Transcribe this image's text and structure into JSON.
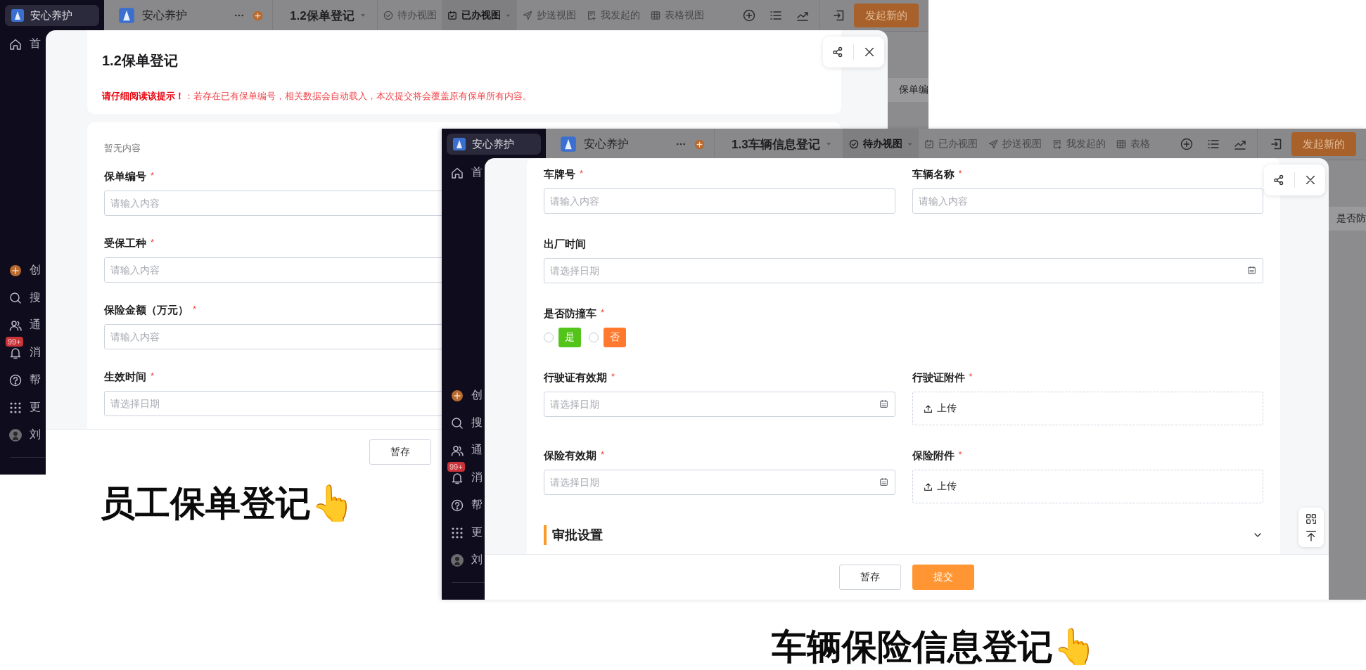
{
  "shots": [
    {
      "sidebar": {
        "brand": "安心养护",
        "items": [
          {
            "kind": "home",
            "label": "首"
          }
        ],
        "bottom_items": [
          {
            "kind": "create",
            "label": "创"
          },
          {
            "kind": "search",
            "label": "搜"
          },
          {
            "kind": "contacts",
            "label": "通"
          },
          {
            "kind": "bell",
            "label": "消",
            "badge": "99+"
          },
          {
            "kind": "help",
            "label": "帮"
          },
          {
            "kind": "apps",
            "label": "更"
          },
          {
            "kind": "avatar",
            "label": "刘"
          }
        ]
      },
      "topbar": {
        "app_name": "安心养护",
        "form_name": "1.2保单登记",
        "views": [
          {
            "kind": "todo",
            "label": "待办视图",
            "selected": false
          },
          {
            "kind": "done",
            "label": "已办视图",
            "selected": true
          },
          {
            "kind": "cc",
            "label": "抄送视图",
            "selected": false
          },
          {
            "kind": "mine",
            "label": "我发起的",
            "selected": false
          },
          {
            "kind": "table",
            "label": "表格视图",
            "selected": false
          }
        ],
        "new_button": "发起新的"
      },
      "behind_column": "保单编",
      "modal": {
        "title": "1.2保单登记",
        "notice": "**请仔细阅读该提示！**：若存在已有保单编号，相关数据会自动载入，本次提交将会覆盖原有保单所有内容。",
        "cards": [
          {
            "hint": "暂无内容",
            "rows": [
              [
                {
                  "kind": "text",
                  "label": "保单编号",
                  "required_mark": "*",
                  "placeholder": "请输入内容"
                }
              ],
              [
                {
                  "kind": "text",
                  "label": "受保工种",
                  "required_mark": "*",
                  "placeholder": "请输入内容"
                }
              ],
              [
                {
                  "kind": "text",
                  "label": "保险金额（万元）",
                  "required_mark": "*",
                  "placeholder": "请输入内容"
                }
              ],
              [
                {
                  "kind": "text",
                  "label": "生效时间",
                  "required_mark": "*",
                  "placeholder": "请选择日期"
                }
              ]
            ]
          }
        ],
        "buttons": [
          {
            "kind": "secondary",
            "label": "暂存"
          }
        ]
      }
    },
    {
      "sidebar": {
        "brand": "安心养护",
        "items": [
          {
            "kind": "home",
            "label": "首"
          }
        ],
        "bottom_items": [
          {
            "kind": "create",
            "label": "创"
          },
          {
            "kind": "search",
            "label": "搜"
          },
          {
            "kind": "contacts",
            "label": "通"
          },
          {
            "kind": "bell",
            "label": "消",
            "badge": "99+"
          },
          {
            "kind": "help",
            "label": "帮"
          },
          {
            "kind": "apps",
            "label": "更"
          },
          {
            "kind": "avatar",
            "label": "刘"
          }
        ]
      },
      "topbar": {
        "app_name": "安心养护",
        "form_name": "1.3车辆信息登记",
        "views": [
          {
            "kind": "todo",
            "label": "待办视图",
            "selected": true
          },
          {
            "kind": "done",
            "label": "已办视图",
            "selected": false
          },
          {
            "kind": "cc",
            "label": "抄送视图",
            "selected": false
          },
          {
            "kind": "mine",
            "label": "我发起的",
            "selected": false
          },
          {
            "kind": "table",
            "label": "表格",
            "selected": false
          }
        ],
        "new_button": "发起新的"
      },
      "behind_column": "是否防",
      "modal": {
        "cards": [
          {
            "rows": [
              [
                {
                  "kind": "text",
                  "label": "车牌号",
                  "required_mark": "*",
                  "placeholder": "请输入内容"
                },
                {
                  "kind": "text",
                  "label": "车辆名称",
                  "required_mark": "*",
                  "placeholder": "请输入内容"
                }
              ],
              [
                {
                  "kind": "date",
                  "label": "出厂时间",
                  "placeholder": "请选择日期"
                }
              ],
              [
                {
                  "kind": "radio",
                  "label": "是否防撞车",
                  "required_mark": "*",
                  "options": [
                    {
                      "label": "是",
                      "color": "#52c41a",
                      "selected": false
                    },
                    {
                      "label": "否",
                      "color": "#ff7a2f",
                      "selected": false
                    }
                  ]
                }
              ],
              [
                {
                  "kind": "date",
                  "label": "行驶证有效期",
                  "required_mark": "*",
                  "placeholder": "请选择日期"
                },
                {
                  "kind": "upload",
                  "label": "行驶证附件",
                  "required_mark": "*",
                  "button": "上传"
                }
              ],
              [
                {
                  "kind": "date",
                  "label": "保险有效期",
                  "required_mark": "*",
                  "placeholder": "请选择日期"
                },
                {
                  "kind": "upload",
                  "label": "保险附件",
                  "required_mark": "*",
                  "button": "上传"
                }
              ]
            ],
            "section": {
              "title": "审批设置",
              "expanded": false
            }
          }
        ],
        "float_tools": [
          {
            "kind": "qr"
          },
          {
            "kind": "top"
          }
        ],
        "buttons": [
          {
            "kind": "secondary",
            "label": "暂存"
          },
          {
            "kind": "primary",
            "label": "提交"
          }
        ]
      }
    }
  ],
  "captions": [
    {
      "text": "员工保单登记👆"
    },
    {
      "text": "车辆保险信息登记👆"
    }
  ]
}
